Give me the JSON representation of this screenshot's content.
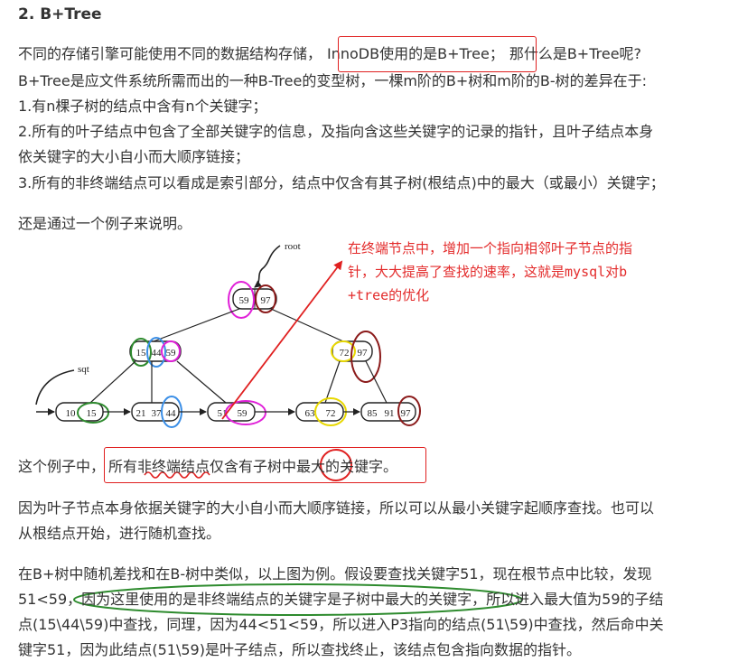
{
  "heading": "2. B+Tree",
  "paragraph1": {
    "line1a": "不同的存储引擎可能使用不同的数据结构存储，",
    "line1b": "InnoDB使用的是B+Tree；",
    "line1c": "那什么是B+Tree呢?",
    "line2": "B+Tree是应文件系统所需而出的一种B-Tree的变型树，一棵m阶的B+树和m阶的B-树的差异在于:",
    "line3": "1.有n棵子树的结点中含有n个关键字；",
    "line4": "2.所有的叶子结点中包含了全部关键字的信息，及指向含这些关键字的记录的指针，且叶子结点本身",
    "line5": "依关键字的大小自小而大顺序链接；",
    "line6": "3.所有的非终端结点可以看成是索引部分，结点中仅含有其子树(根结点)中的最大（或最小）关键字；"
  },
  "example_intro": "还是通过一个例子来说明。",
  "diagram": {
    "root_label": "root",
    "sqt_label": "sqt",
    "root_keys": [
      "59",
      "97"
    ],
    "internal_left": [
      "15",
      "44",
      "59"
    ],
    "internal_right": [
      "72",
      "97"
    ],
    "leaves": [
      [
        "10",
        "15"
      ],
      [
        "21",
        "37",
        "44"
      ],
      [
        "51",
        "59"
      ],
      [
        "63",
        "72"
      ],
      [
        "85",
        "91",
        "97"
      ]
    ],
    "annotation_lines": [
      "在终端节点中，增加一个指向相邻叶子节点的指",
      "针，大大提高了查找的速率，这就是mysql对b",
      "+tree的优化"
    ],
    "colors": {
      "magenta": "#e020d8",
      "darkred": "#8b1a1a",
      "green": "#2e8b2e",
      "blue": "#3a8ee6",
      "yellow": "#e8d800",
      "red": "#e02020"
    }
  },
  "example_line": {
    "prefix": "这个例子中，",
    "boxed": "所有非终端结点仅含有子树中最大的关键字。"
  },
  "paragraph2": {
    "line1": "因为叶子节点本身依据关键字的大小自小而大顺序链接，所以可以从最小关键字起顺序查找。也可以",
    "line2": "从根结点开始，进行随机查找。"
  },
  "paragraph3": {
    "line1": "在B+树中随机差找和在B-树中类似，以上图为例。假设要查找关键字51，现在根节点中比较，发现",
    "line2a": "51<59，",
    "line2b": "因为这里使用的是非终端结点的关键字是子树中最大的关键字",
    "line2c": "，所以进入最大值为59的子结",
    "line3": "点(15\\44\\59)中查找，同理，因为44<51<59，所以进入P3指向的结点(51\\59)中查找，然后命中关",
    "line4": "键字51，因为此结点(51\\59)是叶子结点，所以查找终止，该结点包含指向数据的指针。"
  }
}
